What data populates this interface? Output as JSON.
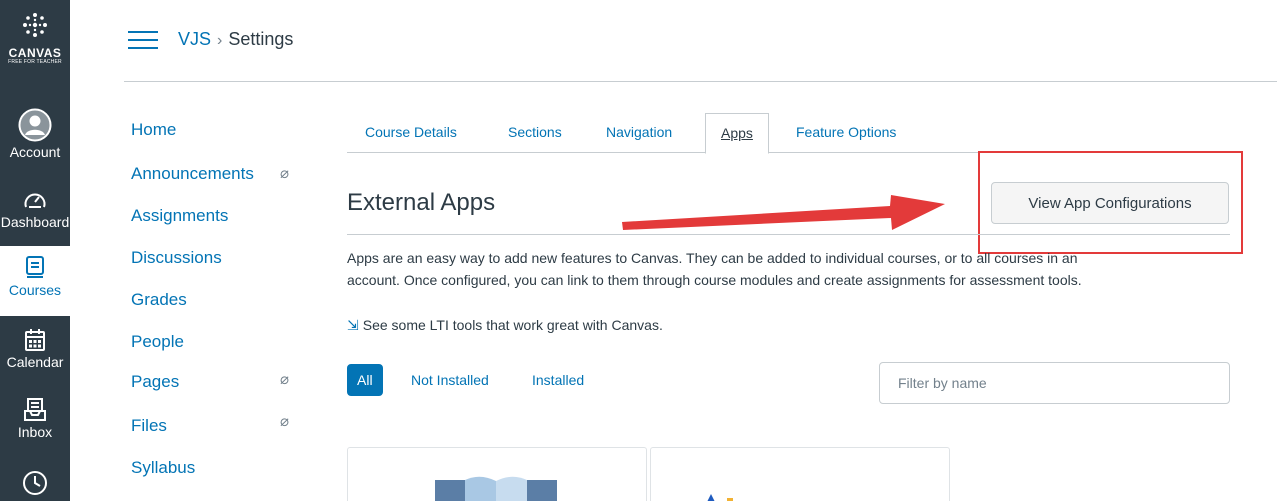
{
  "global_nav": {
    "logo_word": "CANVAS",
    "logo_sub": "FREE FOR TEACHER",
    "items": [
      {
        "label": "Account",
        "icon": "account-icon"
      },
      {
        "label": "Dashboard",
        "icon": "dashboard-icon"
      },
      {
        "label": "Courses",
        "icon": "courses-icon"
      },
      {
        "label": "Calendar",
        "icon": "calendar-icon"
      },
      {
        "label": "Inbox",
        "icon": "inbox-icon"
      },
      {
        "label": "",
        "icon": "history-icon"
      }
    ]
  },
  "breadcrumb": {
    "course": "VJS",
    "separator": "›",
    "current": "Settings"
  },
  "course_nav": {
    "items": [
      {
        "label": "Home",
        "hidden": false
      },
      {
        "label": "Announcements",
        "hidden": true
      },
      {
        "label": "Assignments",
        "hidden": false
      },
      {
        "label": "Discussions",
        "hidden": false
      },
      {
        "label": "Grades",
        "hidden": false
      },
      {
        "label": "People",
        "hidden": false
      },
      {
        "label": "Pages",
        "hidden": true
      },
      {
        "label": "Files",
        "hidden": true
      },
      {
        "label": "Syllabus",
        "hidden": false
      }
    ]
  },
  "tabs": [
    {
      "label": "Course Details",
      "active": false
    },
    {
      "label": "Sections",
      "active": false
    },
    {
      "label": "Navigation",
      "active": false
    },
    {
      "label": "Apps",
      "active": true
    },
    {
      "label": "Feature Options",
      "active": false
    }
  ],
  "content": {
    "heading": "External Apps",
    "config_button": "View App Configurations",
    "description_line1": "Apps are an easy way to add new features to Canvas. They can be added to individual courses, or to all courses in an",
    "description_line2": "account. Once configured, you can link to them through course modules and create assignments for assessment tools.",
    "lti_link": "See some LTI tools that work great with Canvas.",
    "filters": {
      "all": "All",
      "not_installed": "Not Installed",
      "installed": "Installed"
    },
    "filter_placeholder": "Filter by name"
  },
  "colors": {
    "nav_bg": "#2d3b45",
    "link": "#0374b5",
    "annotation": "#e33a3a"
  }
}
